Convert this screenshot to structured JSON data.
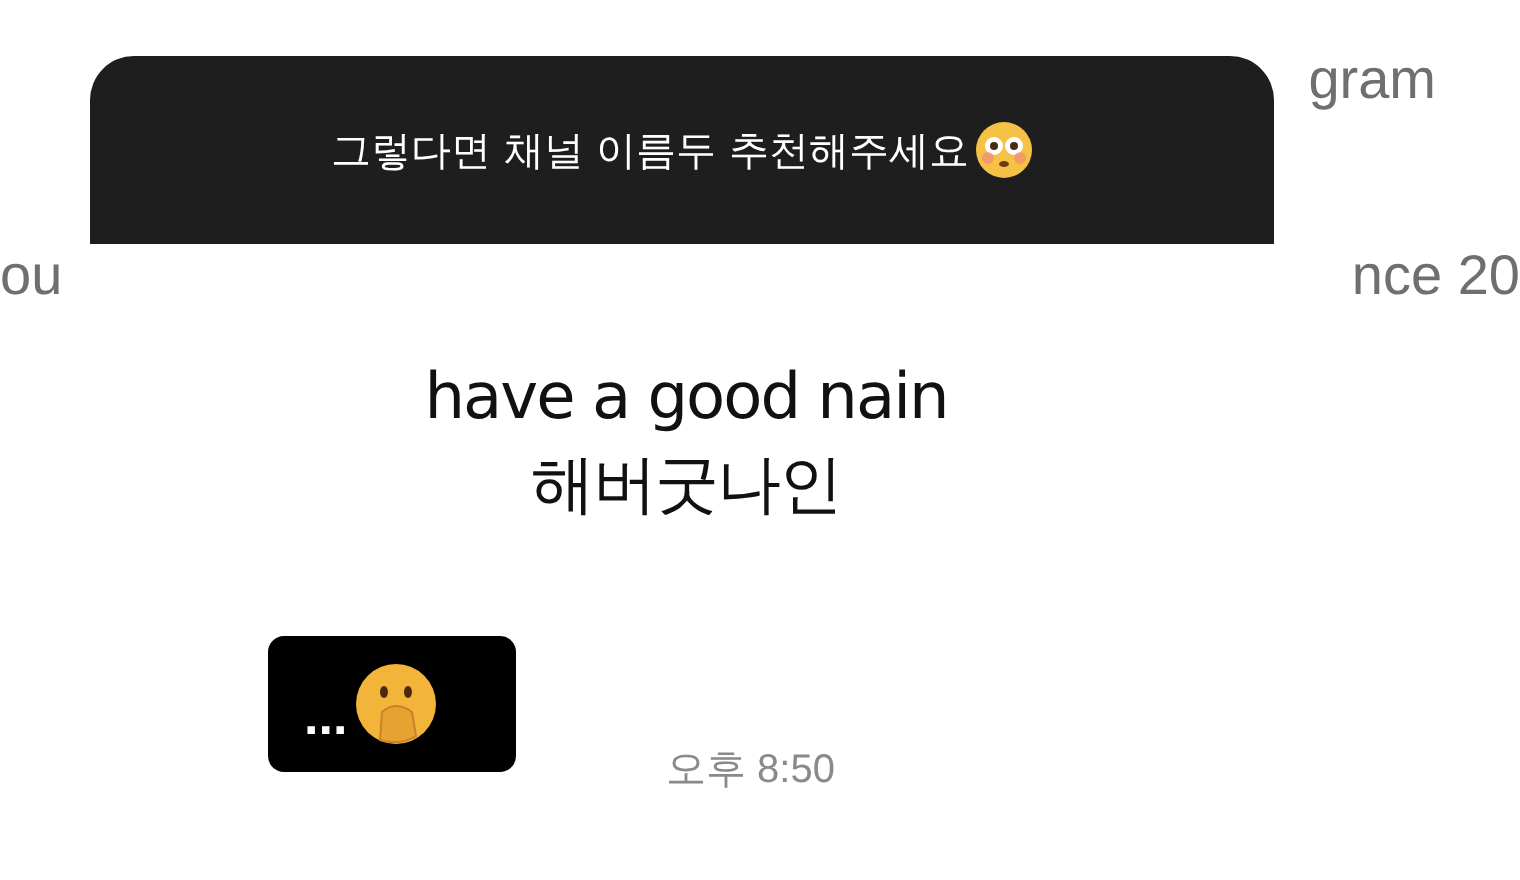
{
  "background_text": {
    "top_right": "gram",
    "left": "ou",
    "right": "nce 20"
  },
  "story_reply": {
    "text": "그렇다면 채널 이름두 추천해주세요"
  },
  "message": {
    "lines": [
      "have a good nain",
      "해버굿나인"
    ]
  },
  "reply": {
    "text": "..."
  },
  "time": "오후 8:50"
}
